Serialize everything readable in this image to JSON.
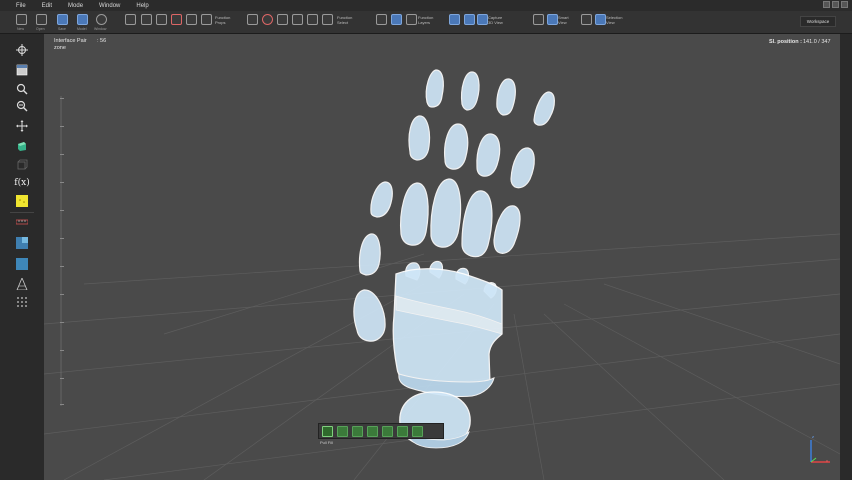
{
  "menu": {
    "items": [
      "File",
      "Edit",
      "Mode",
      "Window",
      "Help"
    ]
  },
  "toolbar": {
    "groups": [
      {
        "label": "Function\nProps"
      },
      {
        "label": "Function\nSelect"
      },
      {
        "label": "Function\nLayers"
      },
      {
        "label": "Capture\n3D View"
      },
      {
        "label": "Smart\nView"
      },
      {
        "label": "Selection\nView"
      }
    ],
    "small_labels": [
      "New",
      "Open",
      "Save",
      "Model",
      "Window"
    ],
    "workspace_label": "Workspace"
  },
  "viewport": {
    "info_label": "Interface Pair\nzone",
    "info_value": ": 56",
    "position_label": "Sl. position :",
    "position_value": "141.0 / 347"
  },
  "leftbar": {
    "icons": [
      "crosshair-icon",
      "calendar-icon",
      "zoom-in-icon",
      "zoom-out-icon",
      "move-icon",
      "cube-icon",
      "cube-outline-icon",
      "function-icon",
      "yellow-square-icon",
      "ruler-icon",
      "layer-cube-icon",
      "blue-square-icon",
      "triangle-icon",
      "grid-dots-icon"
    ],
    "function_label": "f(x)"
  },
  "bottombar": {
    "label": "Pull Fill",
    "buttons": [
      "fill-full-icon",
      "fill-half-icon",
      "fill-a-icon",
      "fill-b-icon",
      "fill-c-icon",
      "fill-d-icon",
      "fill-e-icon"
    ]
  },
  "axes": {
    "x": "x",
    "y": "y",
    "z": "z"
  },
  "colors": {
    "viewport_bg": "#4a4a4a",
    "bone": "#cfe6f7",
    "bone_edge": "#ffffff",
    "grid": "#6a6a6a",
    "accent_green": "#4ca04a"
  }
}
